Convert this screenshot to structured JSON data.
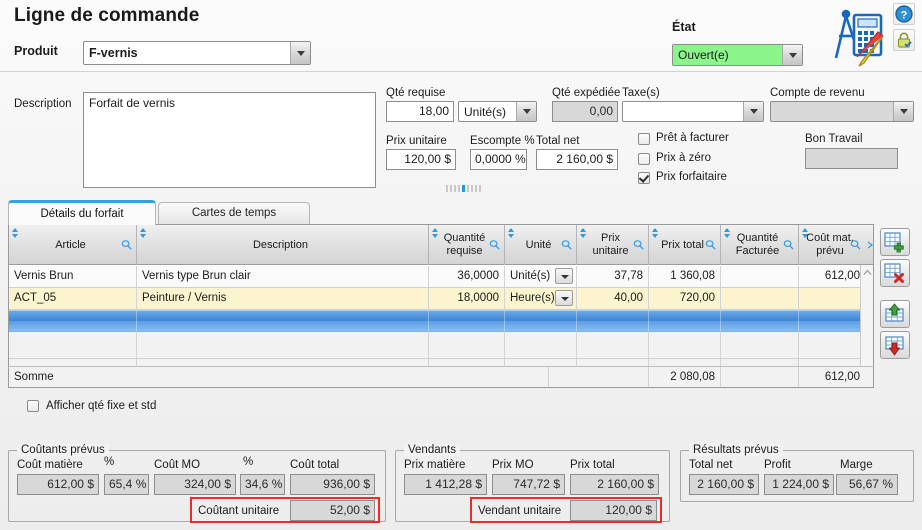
{
  "header": {
    "title": "Ligne de commande",
    "produit_label": "Produit",
    "produit_value": "F-vernis",
    "etat_label": "État",
    "etat_value": "Ouvert(e)",
    "etat_color": "#8bf48b",
    "help_icon": "help-question-icon",
    "lock_icon": "lock-icon",
    "app_icon": "calculator-compass-pencil-icon"
  },
  "form": {
    "description_label": "Description",
    "description_value": "Forfait de vernis",
    "qte_requise_label": "Qté requise",
    "qte_requise_value": "18,00",
    "unite_value": "Unité(s)",
    "qte_expediee_label": "Qté expédiée",
    "qte_expediee_value": "0,00",
    "taxes_label": "Taxe(s)",
    "taxes_value": "",
    "compte_revenu_label": "Compte de revenu",
    "compte_revenu_value": "",
    "prix_unitaire_label": "Prix unitaire",
    "prix_unitaire_value": "120,00 $",
    "escompte_label": "Escompte %",
    "escompte_value": "0,0000 %",
    "total_net_label": "Total net",
    "total_net_value": "2 160,00 $",
    "bon_travail_label": "Bon Travail",
    "bon_travail_value": "",
    "checkboxes": [
      {
        "label": "Prêt à facturer",
        "checked": false
      },
      {
        "label": "Prix à zéro",
        "checked": false
      },
      {
        "label": "Prix forfaitaire",
        "checked": true
      }
    ]
  },
  "tabs": [
    {
      "label": "Détails du forfait",
      "active": true
    },
    {
      "label": "Cartes de temps",
      "active": false
    }
  ],
  "grid": {
    "columns": [
      {
        "label": "Article",
        "sortable": true,
        "filter": true
      },
      {
        "label": "Description",
        "sortable": true,
        "filter": true
      },
      {
        "label": "Quantité requise",
        "sortable": true,
        "filter": true
      },
      {
        "label": "Unité",
        "sortable": true,
        "filter": true
      },
      {
        "label": "Prix unitaire",
        "sortable": true,
        "filter": true
      },
      {
        "label": "Prix total",
        "sortable": true,
        "filter": true
      },
      {
        "label": "Quantité Facturée",
        "sortable": true,
        "filter": true
      },
      {
        "label": "Coût mat. prévu",
        "sortable": true,
        "filter": true
      }
    ],
    "rows": [
      {
        "article": "Vernis Brun",
        "description": "Vernis type Brun clair",
        "quantite_requise": "36,0000",
        "unite": "Unité(s)",
        "prix_unitaire": "37,78",
        "prix_total": "1 360,08",
        "quantite_facturee": "",
        "cout_mat_prevu": "612,00"
      },
      {
        "article": "ACT_05",
        "description": "Peinture /  Vernis",
        "quantite_requise": "18,0000",
        "unite": "Heure(s)",
        "prix_unitaire": "40,00",
        "prix_total": "720,00",
        "quantite_facturee": "",
        "cout_mat_prevu": ""
      }
    ],
    "sum_label": "Somme",
    "sum_prix_total": "2 080,08",
    "sum_cout_mat": "612,00",
    "buttons": [
      {
        "name": "add-row-button",
        "icon": "grid-add-icon"
      },
      {
        "name": "delete-row-button",
        "icon": "grid-delete-icon"
      },
      {
        "name": "move-up-button",
        "icon": "grid-move-up-icon"
      },
      {
        "name": "move-down-button",
        "icon": "grid-move-down-icon"
      }
    ]
  },
  "below_grid": {
    "afficher_label": "Afficher qté fixe et std",
    "afficher_checked": false
  },
  "panels": {
    "couts": {
      "title": "Coûtants prévus",
      "cout_matiere_label": "Coût matière",
      "cout_matiere_value": "612,00 $",
      "pct1_label": "%",
      "pct1_value": "65,4 %",
      "cout_mo_label": "Coût MO",
      "cout_mo_value": "324,00 $",
      "pct2_label": "%",
      "pct2_value": "34,6 %",
      "cout_total_label": "Coût total",
      "cout_total_value": "936,00 $",
      "unitaire_label": "Coûtant unitaire",
      "unitaire_value": "52,00 $",
      "highlight_color": "#ee2b24"
    },
    "vendants": {
      "title": "Vendants",
      "prix_matiere_label": "Prix matière",
      "prix_matiere_value": "1 412,28 $",
      "prix_mo_label": "Prix MO",
      "prix_mo_value": "747,72 $",
      "prix_total_label": "Prix total",
      "prix_total_value": "2 160,00 $",
      "unitaire_label": "Vendant unitaire",
      "unitaire_value": "120,00 $",
      "highlight_color": "#ee2b24"
    },
    "resultats": {
      "title": "Résultats prévus",
      "total_net_label": "Total net",
      "total_net_value": "2 160,00 $",
      "profit_label": "Profit",
      "profit_value": "1 224,00 $",
      "marge_label": "Marge",
      "marge_value": "56,67 %"
    }
  }
}
